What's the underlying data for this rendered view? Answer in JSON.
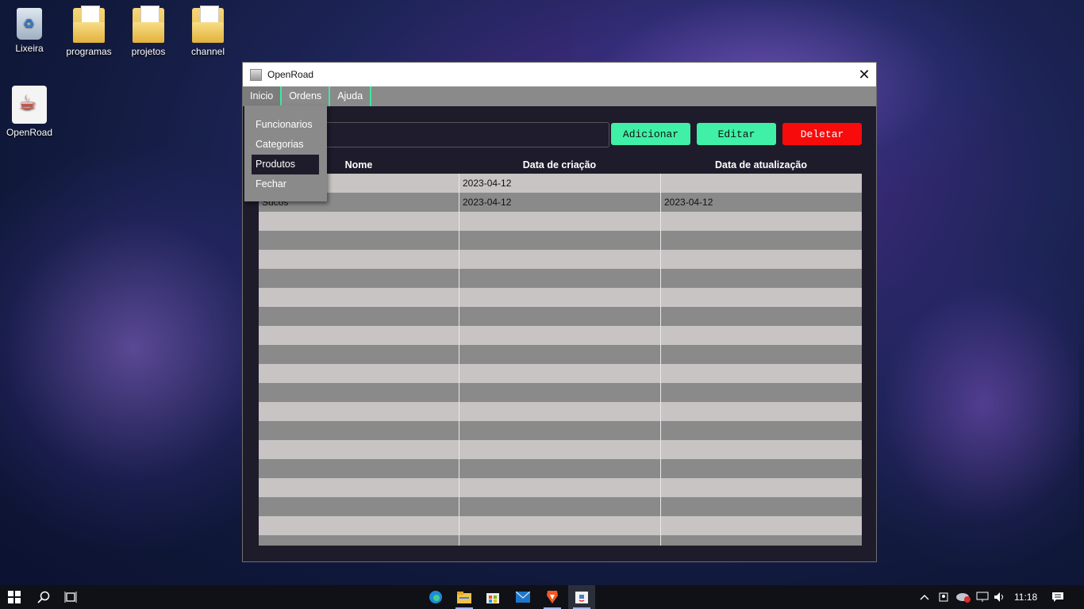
{
  "desktop": {
    "icons": [
      {
        "label": "Lixeira",
        "icon": "recycle-bin-icon"
      },
      {
        "label": "programas",
        "icon": "folder-icon"
      },
      {
        "label": "projetos",
        "icon": "folder-icon"
      },
      {
        "label": "channel",
        "icon": "folder-shortcut-icon"
      },
      {
        "label": "OpenRoad",
        "icon": "java-app-icon"
      }
    ]
  },
  "window": {
    "title": "OpenRoad",
    "close_icon": "close-icon",
    "menubar": [
      "Inicio",
      "Ordens",
      "Ajuda"
    ],
    "dropdown": {
      "items": [
        "Funcionarios",
        "Categorias",
        "Produtos",
        "Fechar"
      ],
      "selected": "Produtos"
    },
    "search": {
      "value": ""
    },
    "buttons": {
      "add": "Adicionar",
      "edit": "Editar",
      "delete": "Deletar"
    },
    "table": {
      "columns": [
        "Nome",
        "Data de criação",
        "Data de atualização"
      ],
      "rows": [
        [
          "",
          "2023-04-12",
          ""
        ],
        [
          "Sucos",
          "2023-04-12",
          "2023-04-12"
        ]
      ]
    },
    "colors": {
      "accent": "#3ff0a6",
      "danger": "#f80b0b",
      "panel": "#1e1b2b",
      "menu": "#8a8a8a"
    }
  },
  "taskbar": {
    "apps": [
      "start-icon",
      "search-icon",
      "task-view-icon",
      "edge-icon",
      "file-explorer-icon",
      "store-icon",
      "mail-icon",
      "brave-icon",
      "java-app-icon"
    ],
    "tray": [
      "chevron-up-icon",
      "meet-icon",
      "onedrive-icon",
      "network-icon",
      "volume-icon"
    ],
    "time": "11:18",
    "notification_icon": "notification-icon"
  }
}
